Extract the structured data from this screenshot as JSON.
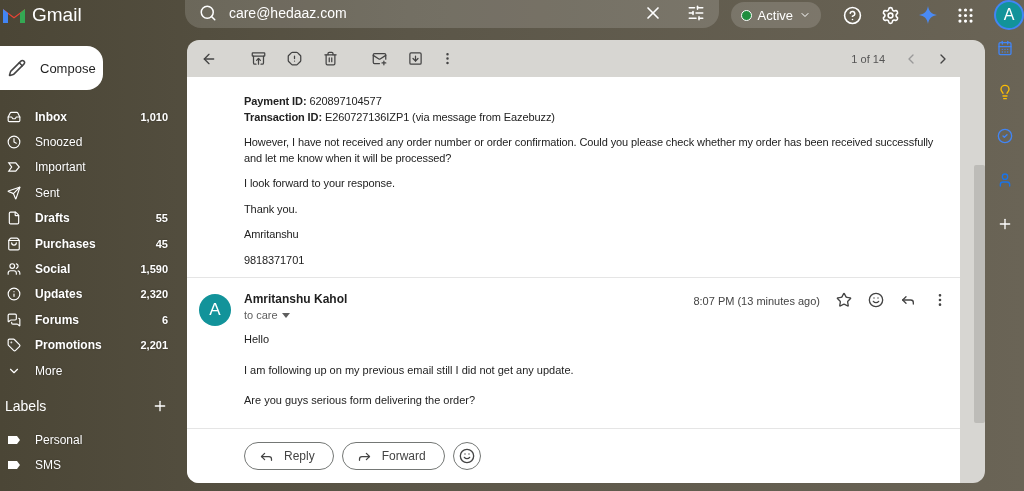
{
  "app": {
    "name": "Gmail"
  },
  "search": {
    "value": "care@hedaaz.com"
  },
  "status": {
    "label": "Active",
    "online": true
  },
  "account": {
    "initial": "A"
  },
  "compose": {
    "label": "Compose"
  },
  "sidebar": {
    "items": [
      {
        "label": "Inbox",
        "count": "1,010",
        "unread": true
      },
      {
        "label": "Snoozed",
        "unread": false
      },
      {
        "label": "Important",
        "unread": false
      },
      {
        "label": "Sent",
        "unread": false
      },
      {
        "label": "Drafts",
        "count": "55",
        "unread": true
      },
      {
        "label": "Purchases",
        "count": "45",
        "unread": true
      },
      {
        "label": "Social",
        "count": "1,590",
        "unread": true
      },
      {
        "label": "Updates",
        "count": "2,320",
        "unread": true
      },
      {
        "label": "Forums",
        "count": "6",
        "unread": true
      },
      {
        "label": "Promotions",
        "count": "2,201",
        "unread": true
      },
      {
        "label": "More",
        "unread": false
      }
    ]
  },
  "labels": {
    "title": "Labels",
    "items": [
      {
        "label": "Personal"
      },
      {
        "label": "SMS"
      }
    ]
  },
  "toolbar": {
    "pagination": "1 of 14"
  },
  "previous_message": {
    "paragraphs": [
      "**Payment ID:** 620897104577\n**Transaction ID:** E260727136IZP1 (via message from Eazebuzz)",
      "However, I have not received any order number or order confirmation. Could you please check whether my order has been received successfully and let me know when it will be processed?",
      "I look forward to your response.",
      "Thank you.",
      "Amritanshu",
      "9818371701"
    ]
  },
  "message": {
    "initial": "A",
    "sender": "Amritanshu Kahol",
    "recipient": "to care",
    "time": "8:07 PM (13 minutes ago)",
    "starred": false,
    "paragraphs": [
      "Hello",
      "I am following up on my previous email still I did not get any update.",
      "Are you guys serious form delivering the order?"
    ]
  },
  "actions": [
    {
      "kind": "reply",
      "label": "Reply"
    },
    {
      "kind": "forward",
      "label": "Forward"
    }
  ]
}
